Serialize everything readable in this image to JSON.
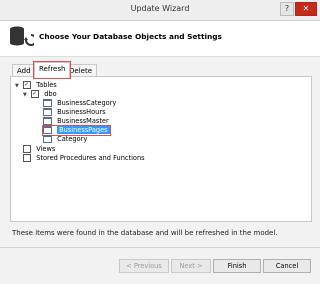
{
  "window": {
    "title": "Update Wizard",
    "close_glyph": "✕",
    "help_glyph": "?"
  },
  "header": {
    "title": "Choose Your Database Objects and Settings"
  },
  "tabs": [
    "Add",
    "Refresh",
    "Delete"
  ],
  "active_tab_index": 1,
  "tree": {
    "root_label": "Tables",
    "schema_label": "dbo",
    "tables": [
      "BusinessCategory",
      "BusinessHours",
      "BusinessMaster",
      "BusinessPages",
      "Category"
    ],
    "selected_table_index": 3,
    "views_label": "Views",
    "procs_label": "Stored Procedures and Functions"
  },
  "status_text": "These items were found in the database and will be refreshed in the model.",
  "buttons": {
    "previous": "< Previous",
    "next": "Next >",
    "finish": "Finish",
    "cancel": "Cancel"
  }
}
